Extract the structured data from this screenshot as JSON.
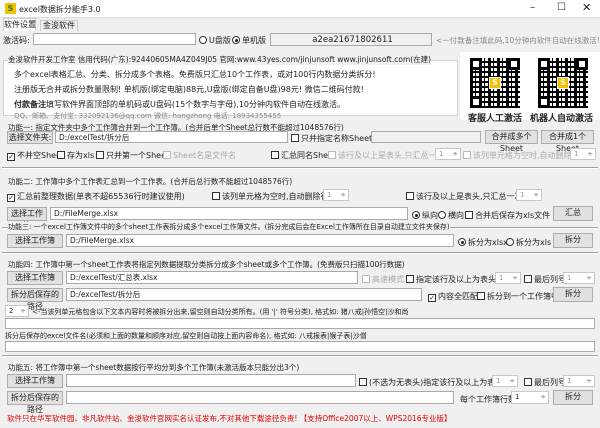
{
  "window": {
    "title": "excel数据拆分能手3.0",
    "logo": "S"
  },
  "tabs": [
    {
      "label": "软件设置"
    },
    {
      "label": "金浚软件"
    }
  ],
  "activation": {
    "label": "激活码:",
    "value": "",
    "radio_u": "U盘版",
    "radio_pc": "单机版",
    "selected": "单机版",
    "machine_code": "a2ea21671802611",
    "hint": "<一付款备注填此码,10分钟内软件自动在线激活!"
  },
  "info": {
    "header": "金浚软件开发工作室 信用代码(广东):92440605MA4Z049J05 官网:www.43yes.com/jinjunsoft  www.jinjunsoft.com(在建)",
    "line1": "多个excel表格汇总、分类、拆分成多个表格。免费版只汇总10个工作表，或对100行内数据分类拆分!",
    "line2": "注册版无合并或拆分数量限制! 单机版(绑定电脑)88元,U盘版(绑定自备U盘)98元! 微信二维码付款!",
    "line3_bold": "付款备注",
    "line3": "填写软件界面顶部的单机码或U盘码(15个数字与字母),10分钟内软件自动在线激活。",
    "contact": "QQ、邮箱、支付宝: 332092136@qq.com   微信: hangzhong   电话: 18934355455",
    "qr1_label": "客服人工激活",
    "qr2_label": "机器人自动激活"
  },
  "f1": {
    "title": "功能一: 指定文件夹中多个工作簿合并到一个工作簿。(合并后单个Sheet总行数不能超过1048576行)",
    "choose": "选择文件夹:",
    "path": "D:/excelTest/拆分后",
    "only_named": "只并指定名称Sheet:",
    "named_value": "",
    "merge_multi": "合并成多个Sheet",
    "merge_one": "合并成1个Sheet",
    "no_empty": "不并空Sheet",
    "save_xls": "存为xls",
    "only_first": "只并第一个Sheet",
    "name_is_file": "Sheet名是文件名",
    "summary_same": "汇总同名Sheet",
    "header_once": "该行及以上是表头,只汇总一次:",
    "header_val": "1",
    "del_empty": "该列单元格为空时,自动删除行:",
    "del_val": "1"
  },
  "f2": {
    "title": "功能二: 工作簿中多个工作表汇总到一个工作表。(合并后总行数不能超过1048576行)",
    "tidy": "汇总前整理数据(单表不超65536行时建议使用)",
    "del_empty": "该列单元格为空时,自动删除行->",
    "del_val": "1",
    "header_once": "该行及以上是表头,只汇总一次->",
    "header_val": "1",
    "choose": "选择工作簿",
    "path": "D:/FileMerge.xlsx",
    "vertical": "纵向",
    "horizontal": "横向",
    "save_xls": "合并后保存为xls文件",
    "run": "汇总"
  },
  "f3": {
    "title": "功能三: 一个excel工作簿文件中的多个sheet工作表拆分成多个excel工作簿文件。(拆分完成后会在Excel工作簿所在目录自动建立文件夹保存)",
    "choose": "选择工作簿",
    "path": "D:/FileMerge.xlsx",
    "to_xlsx": "拆分为xlsx",
    "to_xls": "拆分为xls",
    "run": "拆分"
  },
  "f4": {
    "title": "功能四: 工作簿中第一个sheet工作表将指定列数据提取分类拆分成多个sheet或多个工作簿。(免费版只扫描100行数据)",
    "choose": "选择工作簿",
    "path": "D:/excelTest/汇总表.xlsx",
    "fast": "高速模式",
    "header": "指定该行及以上为表头->",
    "header_val": "1",
    "last_col": "最后列号",
    "last_val": "1",
    "save_path_btn": "拆分后保存的路径",
    "save_path": "D:/excelTest/拆分后",
    "full_match": "内容全匹配",
    "to_one": "拆分到一个工作簿中",
    "run": "拆分",
    "col_val": "2",
    "col_hint": "<-当该列单元格包含以下文本内容时将被拆分出来,留空则自动分类所有。(用 '|' 符号分类), 格式如: 猪八戒|孙悟空|沙和尚",
    "filter_value": "",
    "names_label": "拆分后保存的excel文件名(必须和上面的数量和顺序对应,留空则自动按上面内容命名), 格式如: 八戒报表|猴子表|沙僧",
    "names_value": ""
  },
  "f5": {
    "title": "功能五: 将工作簿中第一个sheet数据按行平均分到多个工作簿(未激活版本只能分出3个)",
    "choose": "选择工作簿",
    "path": "",
    "header": "(不选为无表头)指定该行及以上为表头->",
    "header_val": "1",
    "last_col": "最后列号",
    "last_val": "1",
    "save_path_btn": "拆分后保存的路径",
    "save_path": "",
    "rows_label": "每个工作簿行数:",
    "rows_val": "1",
    "run": "拆分"
  },
  "footer": {
    "text": "软件只在华军软件园、非凡软件站、金浚软件官网实名认证发布,不对其他下载途径负责! 【支持Office2007以上、WPS2016专业版】",
    "color": "#e00000"
  }
}
